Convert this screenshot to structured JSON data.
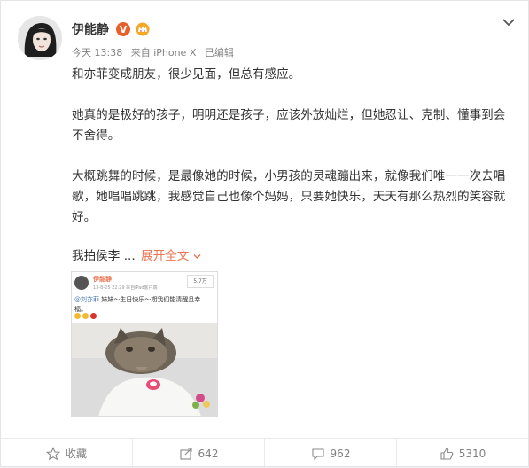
{
  "post": {
    "author": "伊能静",
    "vip_badge": "V",
    "time": "今天 13:38",
    "source": "来自 iPhone X",
    "edited": "已编辑",
    "paragraphs": [
      "和亦菲变成朋友，很少见面，但总有感应。",
      "她真的是极好的孩子，明明还是孩子，应该外放灿烂，但她忍让、克制、懂事到会不舍得。",
      "大概跳舞的时候，是最像她的时候，小男孩的灵魂蹦出来，就像我们唯一一次去唱歌，她唱唱跳跳，我感觉自己也像个妈妈，只要她快乐，天天有那么热烈的笑容就好。"
    ],
    "teaser": "我拍侯李",
    "expand_label": "展开全文",
    "expand_icon": "chevron-down-icon"
  },
  "embedded": {
    "author": "伊能静",
    "meta": "13-8-25 22:29  来自iPad客户端",
    "count": "5.7万",
    "mention": "@刘亦菲",
    "body": " 妹妹～生日快乐～期我们能清醒且幸福。"
  },
  "actions": [
    {
      "icon": "star-icon",
      "label": "收藏"
    },
    {
      "icon": "share-icon",
      "label": "642"
    },
    {
      "icon": "comment-icon",
      "label": "962"
    },
    {
      "icon": "thumbs-up-icon",
      "label": "5310"
    }
  ],
  "colors": {
    "accent": "#eb7350",
    "vip": "#e8612a",
    "text": "#333333",
    "muted": "#808080"
  }
}
